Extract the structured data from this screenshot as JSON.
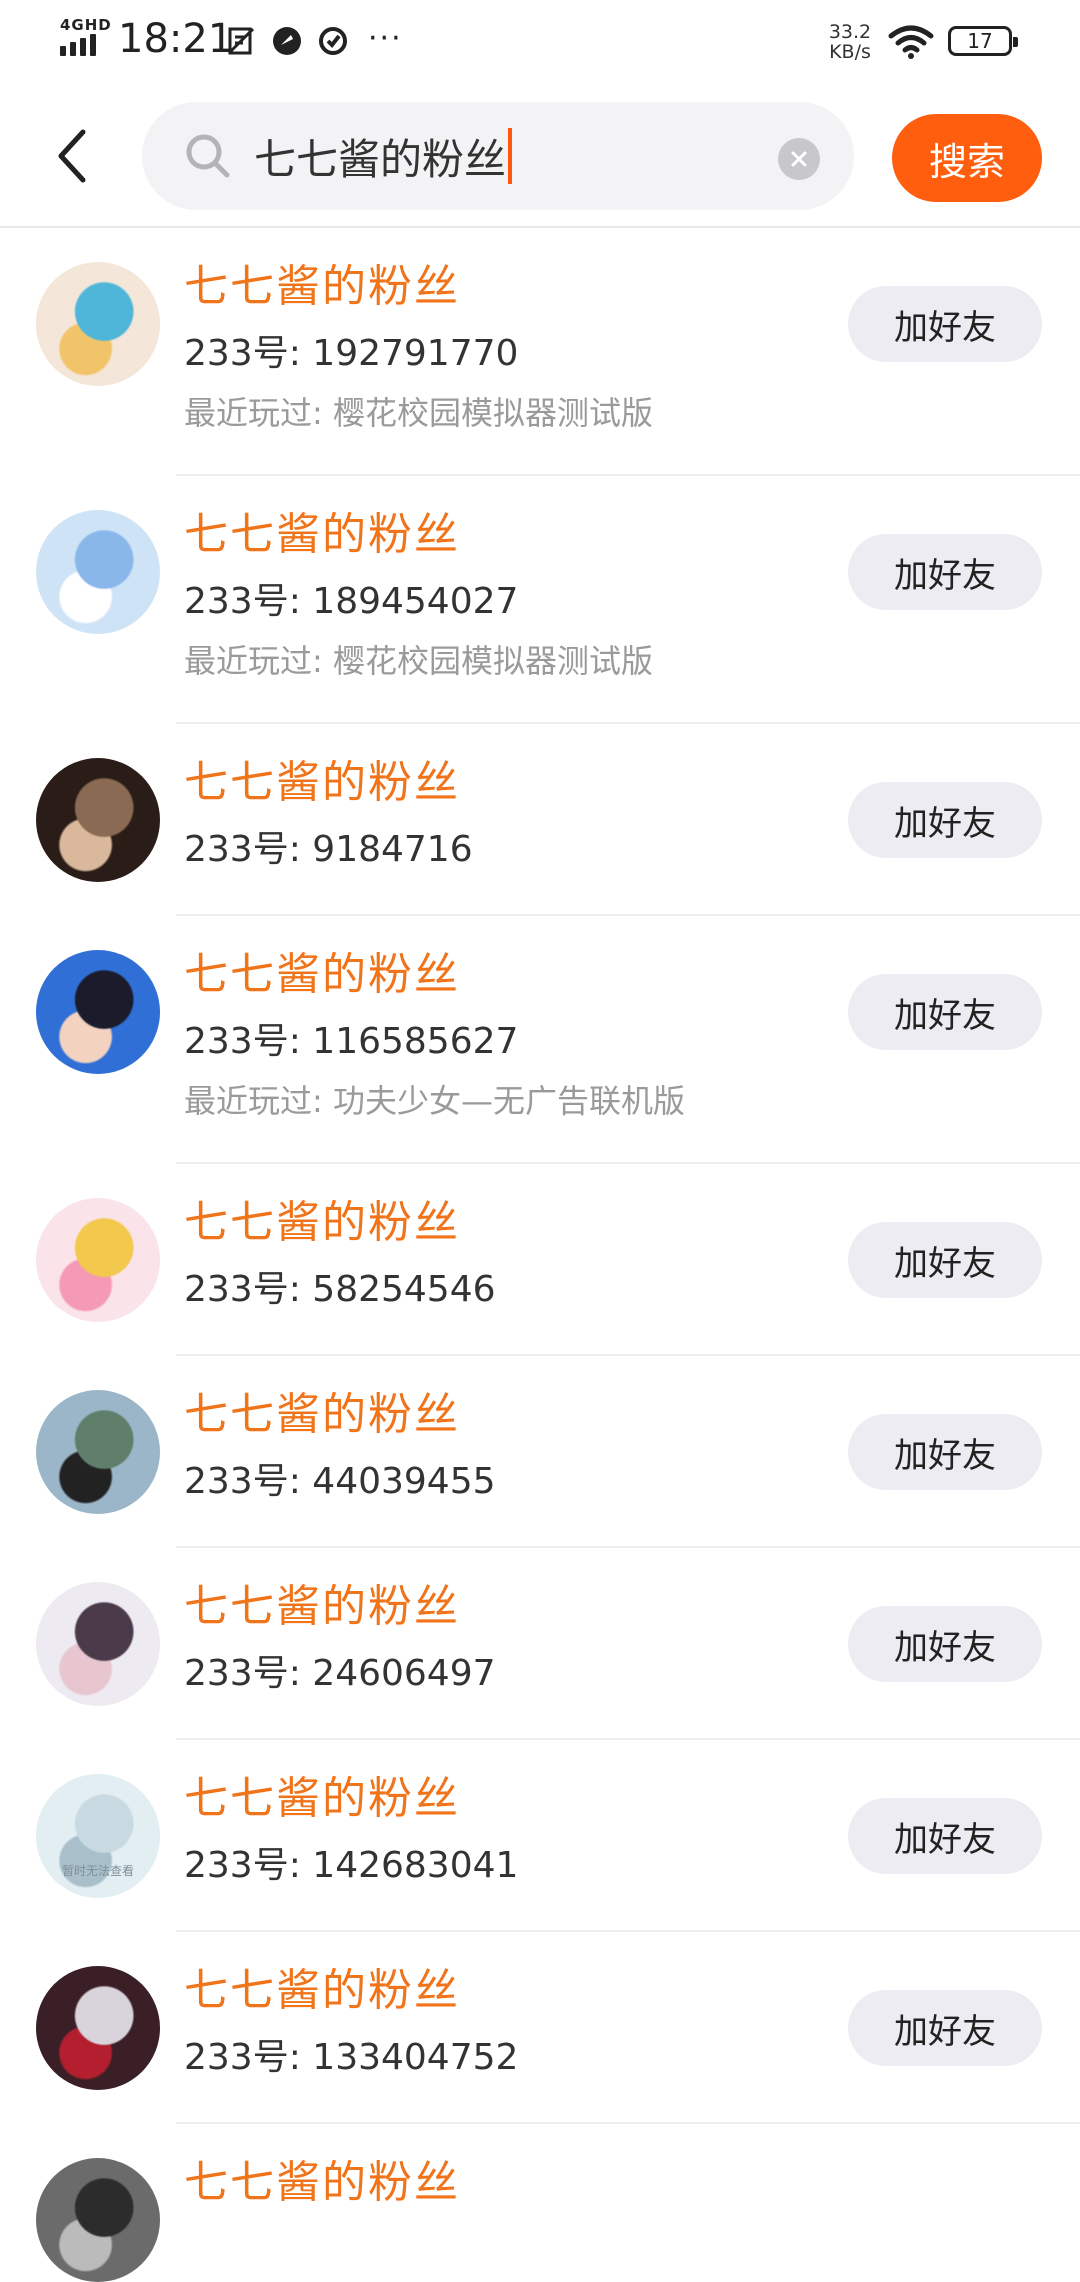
{
  "status_bar": {
    "network": "4GHD",
    "time": "18:21",
    "speed_value": "33.2",
    "speed_unit": "KB/s",
    "battery": "17",
    "icons": [
      "screenshot-icon",
      "app-notification-icon",
      "sync-icon"
    ],
    "more": "···"
  },
  "search": {
    "query": "七七酱的粉丝",
    "search_label": "搜索",
    "accent": "#ff5e0f"
  },
  "results": [
    {
      "name": "七七酱的粉丝",
      "id": "233号: 192791770",
      "recent": "最近玩过: 樱花校园模拟器测试版",
      "button": "加好友",
      "avatar_colors": [
        "#f4e6d8",
        "#4fb6d9",
        "#f2c46a"
      ]
    },
    {
      "name": "七七酱的粉丝",
      "id": "233号: 189454027",
      "recent": "最近玩过: 樱花校园模拟器测试版",
      "button": "加好友",
      "avatar_colors": [
        "#cfe3f7",
        "#8ab7ea",
        "#ffffff"
      ]
    },
    {
      "name": "七七酱的粉丝",
      "id": "233号: 9184716",
      "recent": "",
      "button": "加好友",
      "avatar_colors": [
        "#2a1d18",
        "#8a6a52",
        "#d9b89c"
      ]
    },
    {
      "name": "七七酱的粉丝",
      "id": "233号: 116585627",
      "recent": "最近玩过: 功夫少女—无广告联机版",
      "button": "加好友",
      "avatar_colors": [
        "#2f6fd6",
        "#1b1b2b",
        "#f3d2c0"
      ]
    },
    {
      "name": "七七酱的粉丝",
      "id": "233号: 58254546",
      "recent": "",
      "button": "加好友",
      "avatar_colors": [
        "#fbe3ea",
        "#f2c94c",
        "#f59ab4"
      ]
    },
    {
      "name": "七七酱的粉丝",
      "id": "233号: 44039455",
      "recent": "",
      "button": "加好友",
      "avatar_colors": [
        "#9bb6c8",
        "#5f7f6a",
        "#222222"
      ]
    },
    {
      "name": "七七酱的粉丝",
      "id": "233号: 24606497",
      "recent": "",
      "button": "加好友",
      "avatar_colors": [
        "#eeeaf2",
        "#4a3a4a",
        "#e7c6cf"
      ]
    },
    {
      "name": "七七酱的粉丝",
      "id": "233号: 142683041",
      "recent": "",
      "button": "加好友",
      "avatar_colors": [
        "#e3eef3",
        "#c8d9e2",
        "#a9bfca"
      ],
      "avatar_text": "暂时无法查看"
    },
    {
      "name": "七七酱的粉丝",
      "id": "233号: 133404752",
      "recent": "",
      "button": "加好友",
      "avatar_colors": [
        "#3a2026",
        "#d9d3db",
        "#b31f2f"
      ]
    },
    {
      "name": "七七酱的粉丝",
      "id": "",
      "recent": "",
      "button": "",
      "avatar_colors": [
        "#6b6b6b",
        "#2c2c2c",
        "#bbbbbb"
      ]
    }
  ]
}
